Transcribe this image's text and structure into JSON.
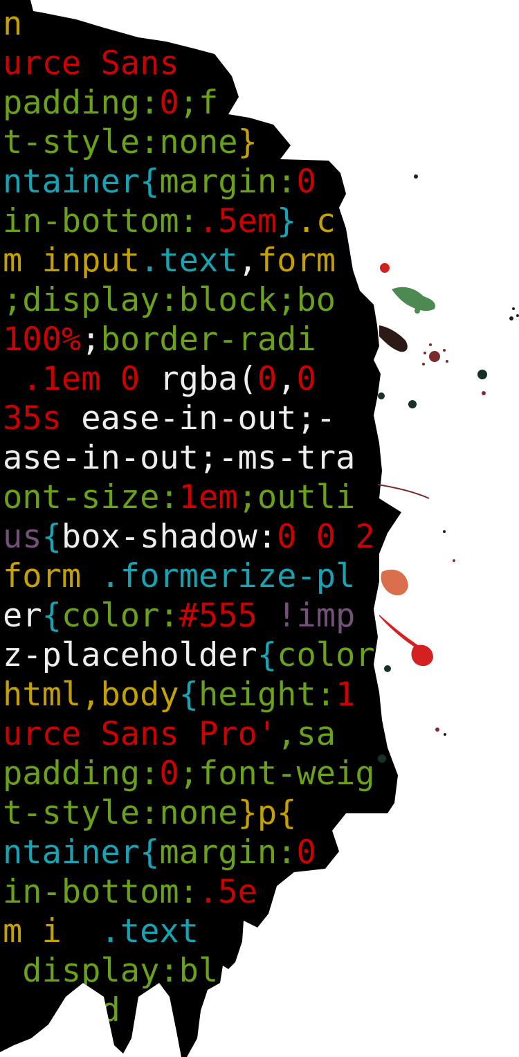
{
  "palette": {
    "background": "#ffffff",
    "ink": "#000000",
    "green": "#6aa11a",
    "red": "#cc0000",
    "cyan": "#16a3b3",
    "yellow": "#c4a000",
    "purple": "#75507b",
    "white": "#eeeeee"
  },
  "code_lines": [
    [
      {
        "t": "n",
        "c": "yellow"
      }
    ],
    [
      {
        "t": "urce Sans",
        "c": "red"
      }
    ],
    [
      {
        "t": "padding",
        "c": "green"
      },
      {
        "t": ":",
        "c": "green"
      },
      {
        "t": "0",
        "c": "red"
      },
      {
        "t": ";",
        "c": "green"
      },
      {
        "t": "f",
        "c": "green"
      }
    ],
    [
      {
        "t": "t-style",
        "c": "green"
      },
      {
        "t": ":",
        "c": "green"
      },
      {
        "t": "none",
        "c": "green"
      },
      {
        "t": "}",
        "c": "yellow"
      }
    ],
    [
      {
        "t": "ntainer",
        "c": "cyan"
      },
      {
        "t": "{",
        "c": "cyan"
      },
      {
        "t": "margin",
        "c": "green"
      },
      {
        "t": ":",
        "c": "green"
      },
      {
        "t": "0",
        "c": "red"
      }
    ],
    [
      {
        "t": "in-bottom",
        "c": "green"
      },
      {
        "t": ":",
        "c": "green"
      },
      {
        "t": ".5em",
        "c": "red"
      },
      {
        "t": "}",
        "c": "cyan"
      },
      {
        "t": ".c",
        "c": "yellow"
      }
    ],
    [
      {
        "t": "m input",
        "c": "yellow"
      },
      {
        "t": ".text",
        "c": "cyan"
      },
      {
        "t": ",",
        "c": "white"
      },
      {
        "t": "form",
        "c": "yellow"
      }
    ],
    [
      {
        "t": ";display",
        "c": "green"
      },
      {
        "t": ":",
        "c": "green"
      },
      {
        "t": "block",
        "c": "green"
      },
      {
        "t": ";",
        "c": "green"
      },
      {
        "t": "bo",
        "c": "green"
      }
    ],
    [
      {
        "t": "100%",
        "c": "red"
      },
      {
        "t": ";",
        "c": "white"
      },
      {
        "t": "border-radi",
        "c": "green"
      }
    ],
    [
      {
        "t": " .1em 0 ",
        "c": "red"
      },
      {
        "t": "rgba(",
        "c": "white"
      },
      {
        "t": "0",
        "c": "red"
      },
      {
        "t": ",",
        "c": "white"
      },
      {
        "t": "0",
        "c": "red"
      }
    ],
    [
      {
        "t": "35s ",
        "c": "red"
      },
      {
        "t": "ease-in-out;-",
        "c": "white"
      }
    ],
    [
      {
        "t": "ase-in-out;-ms-tra",
        "c": "white"
      }
    ],
    [
      {
        "t": "ont-size",
        "c": "green"
      },
      {
        "t": ":",
        "c": "green"
      },
      {
        "t": "1em",
        "c": "red"
      },
      {
        "t": ";",
        "c": "green"
      },
      {
        "t": "outli",
        "c": "green"
      }
    ],
    [
      {
        "t": "us",
        "c": "purple"
      },
      {
        "t": "{",
        "c": "cyan"
      },
      {
        "t": "box-shadow:",
        "c": "white"
      },
      {
        "t": "0 0 2",
        "c": "red"
      }
    ],
    [
      {
        "t": "form ",
        "c": "yellow"
      },
      {
        "t": ".formerize-pl",
        "c": "cyan"
      }
    ],
    [
      {
        "t": "er",
        "c": "white"
      },
      {
        "t": "{",
        "c": "cyan"
      },
      {
        "t": "color",
        "c": "green"
      },
      {
        "t": ":",
        "c": "green"
      },
      {
        "t": "#555 ",
        "c": "red"
      },
      {
        "t": "!imp",
        "c": "purple"
      }
    ],
    [
      {
        "t": "z-placeholder",
        "c": "white"
      },
      {
        "t": "{",
        "c": "cyan"
      },
      {
        "t": "color",
        "c": "green"
      }
    ],
    [
      {
        "t": "html,body",
        "c": "yellow"
      },
      {
        "t": "{",
        "c": "cyan"
      },
      {
        "t": "height",
        "c": "green"
      },
      {
        "t": ":",
        "c": "green"
      },
      {
        "t": "1",
        "c": "red"
      }
    ],
    [
      {
        "t": "urce Sans Pro'",
        "c": "red"
      },
      {
        "t": ",sa",
        "c": "green"
      }
    ],
    [
      {
        "t": "padding",
        "c": "green"
      },
      {
        "t": ":",
        "c": "green"
      },
      {
        "t": "0",
        "c": "red"
      },
      {
        "t": ";font-weig",
        "c": "green"
      }
    ],
    [
      {
        "t": "t-style",
        "c": "green"
      },
      {
        "t": ":",
        "c": "green"
      },
      {
        "t": "none",
        "c": "green"
      },
      {
        "t": "}",
        "c": "yellow"
      },
      {
        "t": "p{",
        "c": "yellow"
      }
    ],
    [
      {
        "t": "ntainer",
        "c": "cyan"
      },
      {
        "t": "{",
        "c": "cyan"
      },
      {
        "t": "margin",
        "c": "green"
      },
      {
        "t": ":",
        "c": "green"
      },
      {
        "t": "0",
        "c": "red"
      }
    ],
    [
      {
        "t": "in-bottom",
        "c": "green"
      },
      {
        "t": ":",
        "c": "green"
      },
      {
        "t": ".5e",
        "c": "red"
      }
    ],
    [
      {
        "t": "m i",
        "c": "yellow"
      },
      {
        "t": "  ",
        "c": "white"
      },
      {
        "t": ".text",
        "c": "cyan"
      }
    ],
    [
      {
        "t": " ",
        "c": "white"
      },
      {
        "t": "display:",
        "c": "green"
      },
      {
        "t": "bl",
        "c": "green"
      }
    ],
    [
      {
        "t": "    ",
        "c": "white"
      },
      {
        "t": "rd",
        "c": "green"
      }
    ]
  ]
}
